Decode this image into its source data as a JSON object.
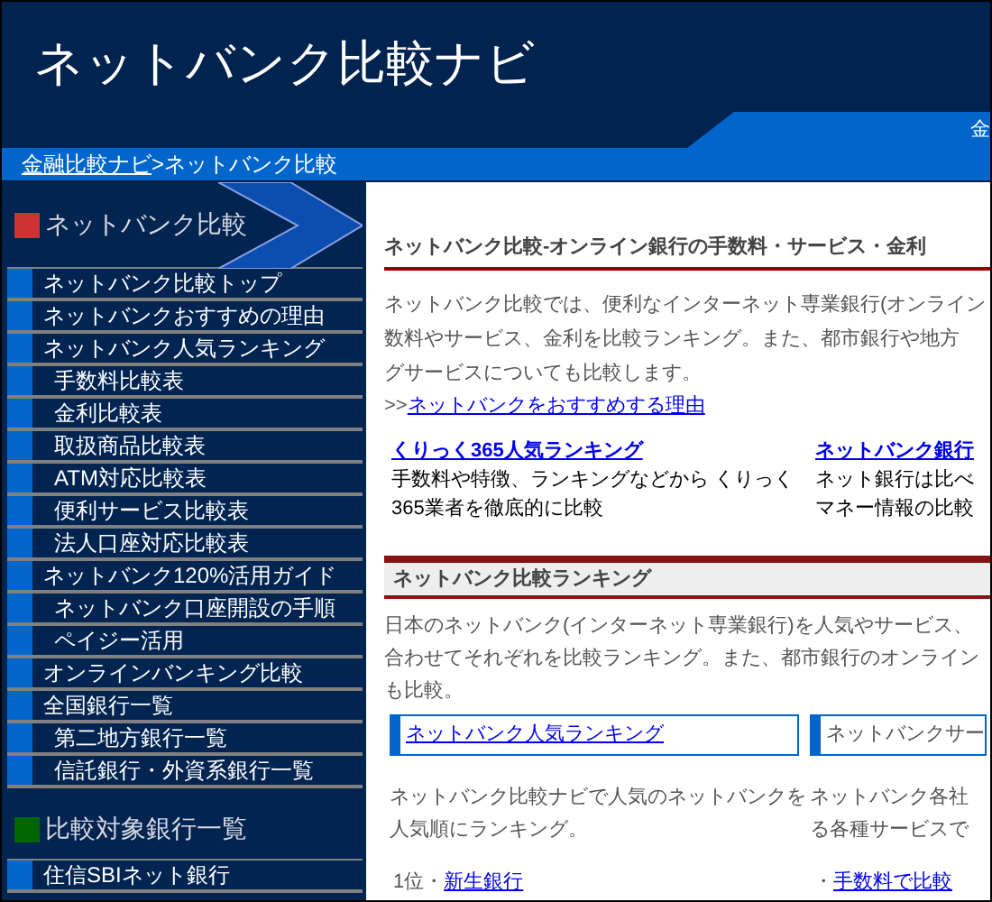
{
  "header": {
    "title": "ネットバンク比較ナビ",
    "tab_fragment": "金"
  },
  "breadcrumb": [
    {
      "label": "金融比較ナビ",
      "link": true
    },
    {
      "label": ">ネットバンク比較",
      "link": false
    }
  ],
  "sidebar": {
    "sections": [
      {
        "title": "ネットバンク比較",
        "color": "#cc3333",
        "items": [
          {
            "label": "ネットバンク比較トップ"
          },
          {
            "label": "ネットバンクおすすめの理由"
          },
          {
            "label": "ネットバンク人気ランキング",
            "children": [
              {
                "label": "手数料比較表"
              },
              {
                "label": "金利比較表"
              },
              {
                "label": "取扱商品比較表"
              },
              {
                "label": "ATM対応比較表"
              },
              {
                "label": "便利サービス比較表"
              },
              {
                "label": "法人口座対応比較表"
              }
            ]
          },
          {
            "label": "ネットバンク120%活用ガイド",
            "children": [
              {
                "label": "ネットバンク口座開設の手順"
              },
              {
                "label": "ペイジー活用"
              }
            ]
          },
          {
            "label": "オンラインバンキング比較"
          },
          {
            "label": "全国銀行一覧",
            "children": [
              {
                "label": "第二地方銀行一覧"
              },
              {
                "label": "信託銀行・外資系銀行一覧"
              }
            ]
          }
        ]
      },
      {
        "title": "比較対象銀行一覧",
        "color": "#006600",
        "items": [
          {
            "label": "住信SBIネット銀行"
          }
        ]
      }
    ]
  },
  "main": {
    "intro": {
      "heading": "ネットバンク比較-オンライン銀行の手数料・サービス・金利",
      "lines": [
        "ネットバンク比較では、便利なインターネット専業銀行(オンライン",
        "数料やサービス、金利を比較ランキング。また、都市銀行や地方",
        "グサービスについても比較します。"
      ],
      "more_prefix": ">>",
      "more_link": "ネットバンクをおすすめする理由",
      "features": [
        {
          "title": "くりっく365人気ランキング",
          "lines": [
            "手数料や特徴、ランキングなどから くりっく",
            "365業者を徹底的に比較"
          ]
        },
        {
          "title": "ネットバンク銀行",
          "lines": [
            "ネット銀行は比べ",
            "マネー情報の比較"
          ]
        }
      ]
    },
    "ranking": {
      "heading": "ネットバンク比較ランキング",
      "lines": [
        "日本のネットバンク(インターネット専業銀行)を人気やサービス、",
        "合わせてそれぞれを比較ランキング。また、都市銀行のオンライン",
        "も比較。"
      ],
      "columns": [
        {
          "tab": "ネットバンク人気ランキング",
          "tab_link": true,
          "lines": [
            "ネットバンク比較ナビで人気のネットバンクを",
            "人気順にランキング。"
          ],
          "entry_prefix": "1位・",
          "entry_link": "新生銀行"
        },
        {
          "tab": "ネットバンクサー",
          "tab_link": false,
          "lines": [
            "ネットバンク各社",
            "る各種サービスで"
          ],
          "entry_prefix": "・",
          "entry_link": "手数料で比較"
        }
      ]
    }
  }
}
